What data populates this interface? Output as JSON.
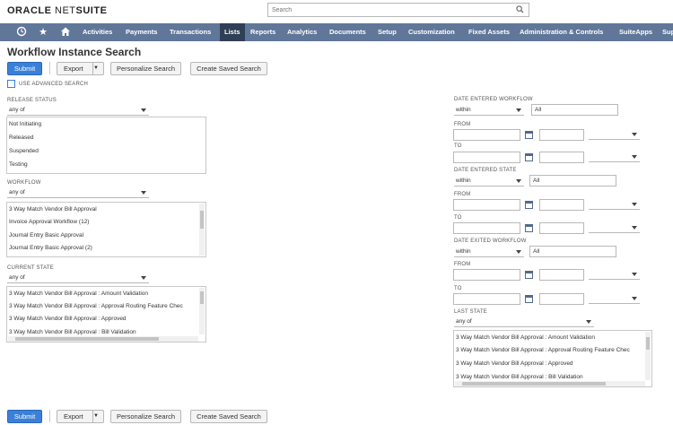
{
  "header": {
    "logo_oracle": "ORACLE",
    "logo_net": " NET",
    "logo_suite": "SUITE",
    "search_placeholder": "Search"
  },
  "nav": {
    "items": [
      {
        "label": "Activities"
      },
      {
        "label": "Payments"
      },
      {
        "label": "Transactions"
      },
      {
        "label": "Lists"
      },
      {
        "label": "Reports"
      },
      {
        "label": "Analytics"
      },
      {
        "label": "Documents"
      },
      {
        "label": "Setup"
      },
      {
        "label": "Customization"
      },
      {
        "label": "Fixed Assets"
      },
      {
        "label": "Administration & Controls"
      },
      {
        "label": "SuiteApps"
      },
      {
        "label": "Sup"
      }
    ],
    "active": "Lists"
  },
  "page": {
    "title": "Workflow Instance Search",
    "submit": "Submit",
    "export": "Export",
    "personalize": "Personalize Search",
    "create_saved": "Create Saved Search",
    "use_advanced": "USE ADVANCED SEARCH"
  },
  "left": {
    "release_status": {
      "label": "RELEASE STATUS",
      "selector": "any of",
      "options": [
        "Not Initiating",
        "Released",
        "Suspended",
        "Testing"
      ]
    },
    "workflow": {
      "label": "WORKFLOW",
      "selector": "any of",
      "options": [
        "3 Way Match Vendor Bill Approval",
        "Invoice Approval Workflow (12)",
        "Journal Entry Basic Approval",
        "Journal Entry Basic Approval (2)"
      ]
    },
    "current_state": {
      "label": "CURRENT STATE",
      "selector": "any of",
      "options": [
        "3 Way Match Vendor Bill Approval : Amount Validation",
        "3 Way Match Vendor Bill Approval : Approval Routing Feature Chec",
        "3 Way Match Vendor Bill Approval : Approved",
        "3 Way Match Vendor Bill Approval : Bill Validation"
      ]
    }
  },
  "right": {
    "date_entered_workflow": {
      "label": "DATE ENTERED WORKFLOW",
      "operator": "within",
      "value": "All"
    },
    "from": "FROM",
    "to": "TO",
    "date_entered_state": {
      "label": "DATE ENTERED STATE",
      "operator": "within",
      "value": "All"
    },
    "date_exited_workflow": {
      "label": "DATE EXITED WORKFLOW",
      "operator": "within",
      "value": "All"
    },
    "last_state": {
      "label": "LAST STATE",
      "selector": "any of",
      "options": [
        "3 Way Match Vendor Bill Approval : Amount Validation",
        "3 Way Match Vendor Bill Approval : Approval Routing Feature Chec",
        "3 Way Match Vendor Bill Approval : Approved",
        "3 Way Match Vendor Bill Approval : Bill Validation"
      ]
    }
  }
}
